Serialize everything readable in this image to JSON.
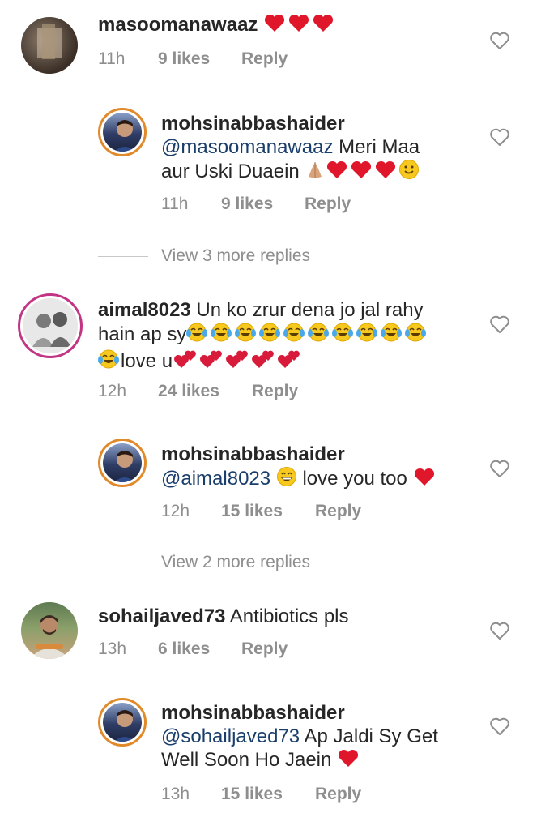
{
  "comments": [
    {
      "username": "masoomanawaaz",
      "text_parts": [
        ""
      ],
      "emojis": "hearts3",
      "time": "11h",
      "likes": "9 likes",
      "reply": "Reply"
    },
    {
      "username": "mohsinabbashaider",
      "mention": "@masoomanawaaz",
      "text_line1": " Meri Maa",
      "text_line2": "aur Uski Duaein ",
      "time": "11h",
      "likes": "9 likes",
      "reply": "Reply"
    },
    {
      "view_more": "View 3 more replies"
    },
    {
      "username": "aimal8023",
      "text_line1": " Un ko zrur dena jo jal rahy",
      "text_line2": "hain ap sy",
      "text_line3": "love u",
      "time": "12h",
      "likes": "24 likes",
      "reply": "Reply"
    },
    {
      "username": "mohsinabbashaider",
      "mention": "@aimal8023",
      "text_line1": " love you too ",
      "time": "12h",
      "likes": "15 likes",
      "reply": "Reply"
    },
    {
      "view_more": "View 2 more replies"
    },
    {
      "username": "sohailjaved73",
      "text_line1": " Antibiotics pls",
      "time": "13h",
      "likes": "6 likes",
      "reply": "Reply"
    },
    {
      "username": "mohsinabbashaider",
      "mention": "@sohailjaved73",
      "text_line1": " Ap Jaldi Sy Get",
      "text_line2": "Well Soon Ho Jaein ",
      "time": "13h",
      "likes": "15 likes",
      "reply": "Reply"
    }
  ],
  "colors": {
    "heart": "#e0162b",
    "muted": "#8e8e8e",
    "mention": "#1a3e6b",
    "story_ring": "#e08a2b"
  }
}
